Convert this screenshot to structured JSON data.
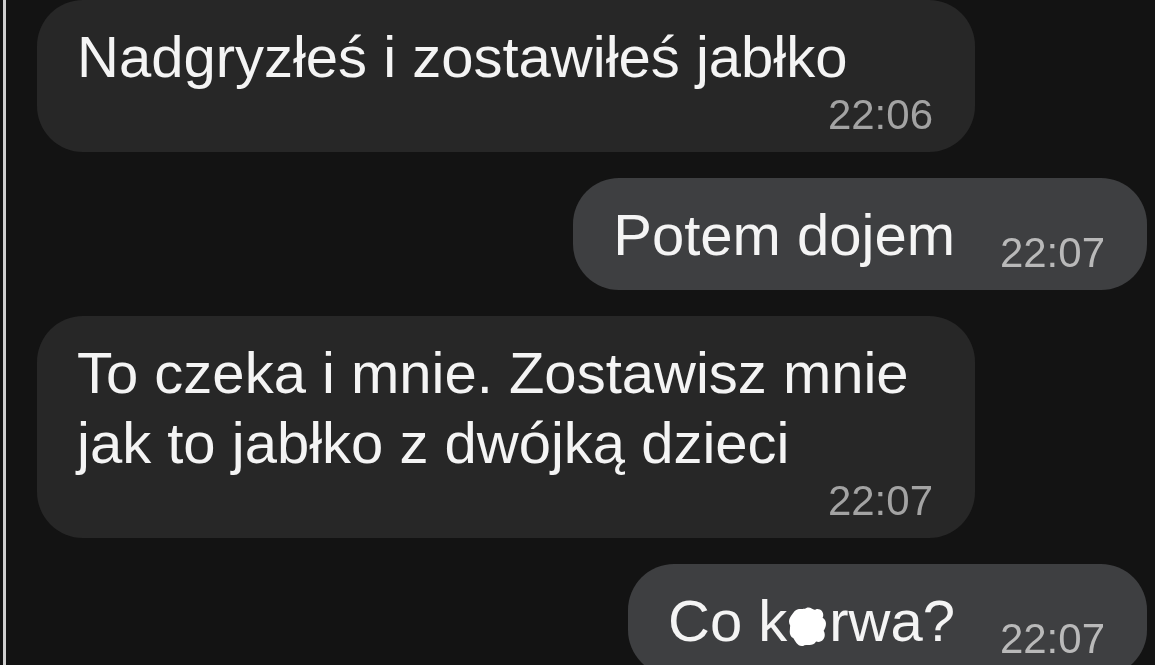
{
  "chat": {
    "messages": [
      {
        "kind": "received",
        "parts": [
          {
            "kind": "text",
            "text": "Nadgryzłeś i zostawiłeś jabłko"
          }
        ],
        "time": "22:06"
      },
      {
        "kind": "sent",
        "parts": [
          {
            "kind": "text",
            "text": "Potem dojem"
          }
        ],
        "time": "22:07"
      },
      {
        "kind": "received",
        "parts": [
          {
            "kind": "text",
            "text": "To czeka i mnie. Zostawisz mnie jak to jabłko z dwójką dzieci"
          }
        ],
        "time": "22:07"
      },
      {
        "kind": "sent",
        "parts": [
          {
            "kind": "text",
            "text": "Co k"
          },
          {
            "kind": "blot"
          },
          {
            "kind": "text",
            "text": "rwa?"
          }
        ],
        "time": "22:07"
      }
    ]
  }
}
